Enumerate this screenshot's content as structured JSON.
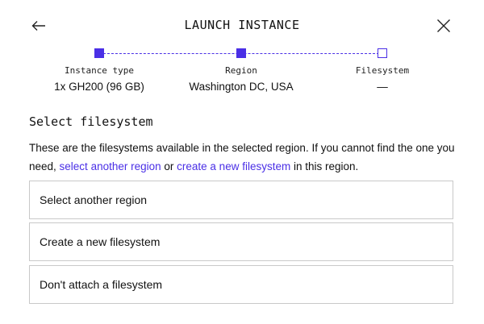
{
  "header": {
    "title": "LAUNCH INSTANCE",
    "back_icon": "arrow-left-icon",
    "close_icon": "close-icon"
  },
  "stepper": {
    "steps": [
      {
        "label": "Instance type",
        "value": "1x GH200 (96 GB)",
        "state": "complete"
      },
      {
        "label": "Region",
        "value": "Washington DC, USA",
        "state": "complete"
      },
      {
        "label": "Filesystem",
        "value": "—",
        "state": "current"
      }
    ],
    "accent_color": "#4a2fe6"
  },
  "section": {
    "title": "Select filesystem",
    "desc_part1": "These are the filesystems available in the selected region. If you cannot find the one you need, ",
    "link_select_region": "select another region",
    "desc_part2": " or ",
    "link_create_fs": "create a new filesystem",
    "desc_part3": " in this region."
  },
  "options": [
    {
      "label": "Select another region"
    },
    {
      "label": "Create a new filesystem"
    },
    {
      "label": "Don't attach a filesystem"
    }
  ]
}
